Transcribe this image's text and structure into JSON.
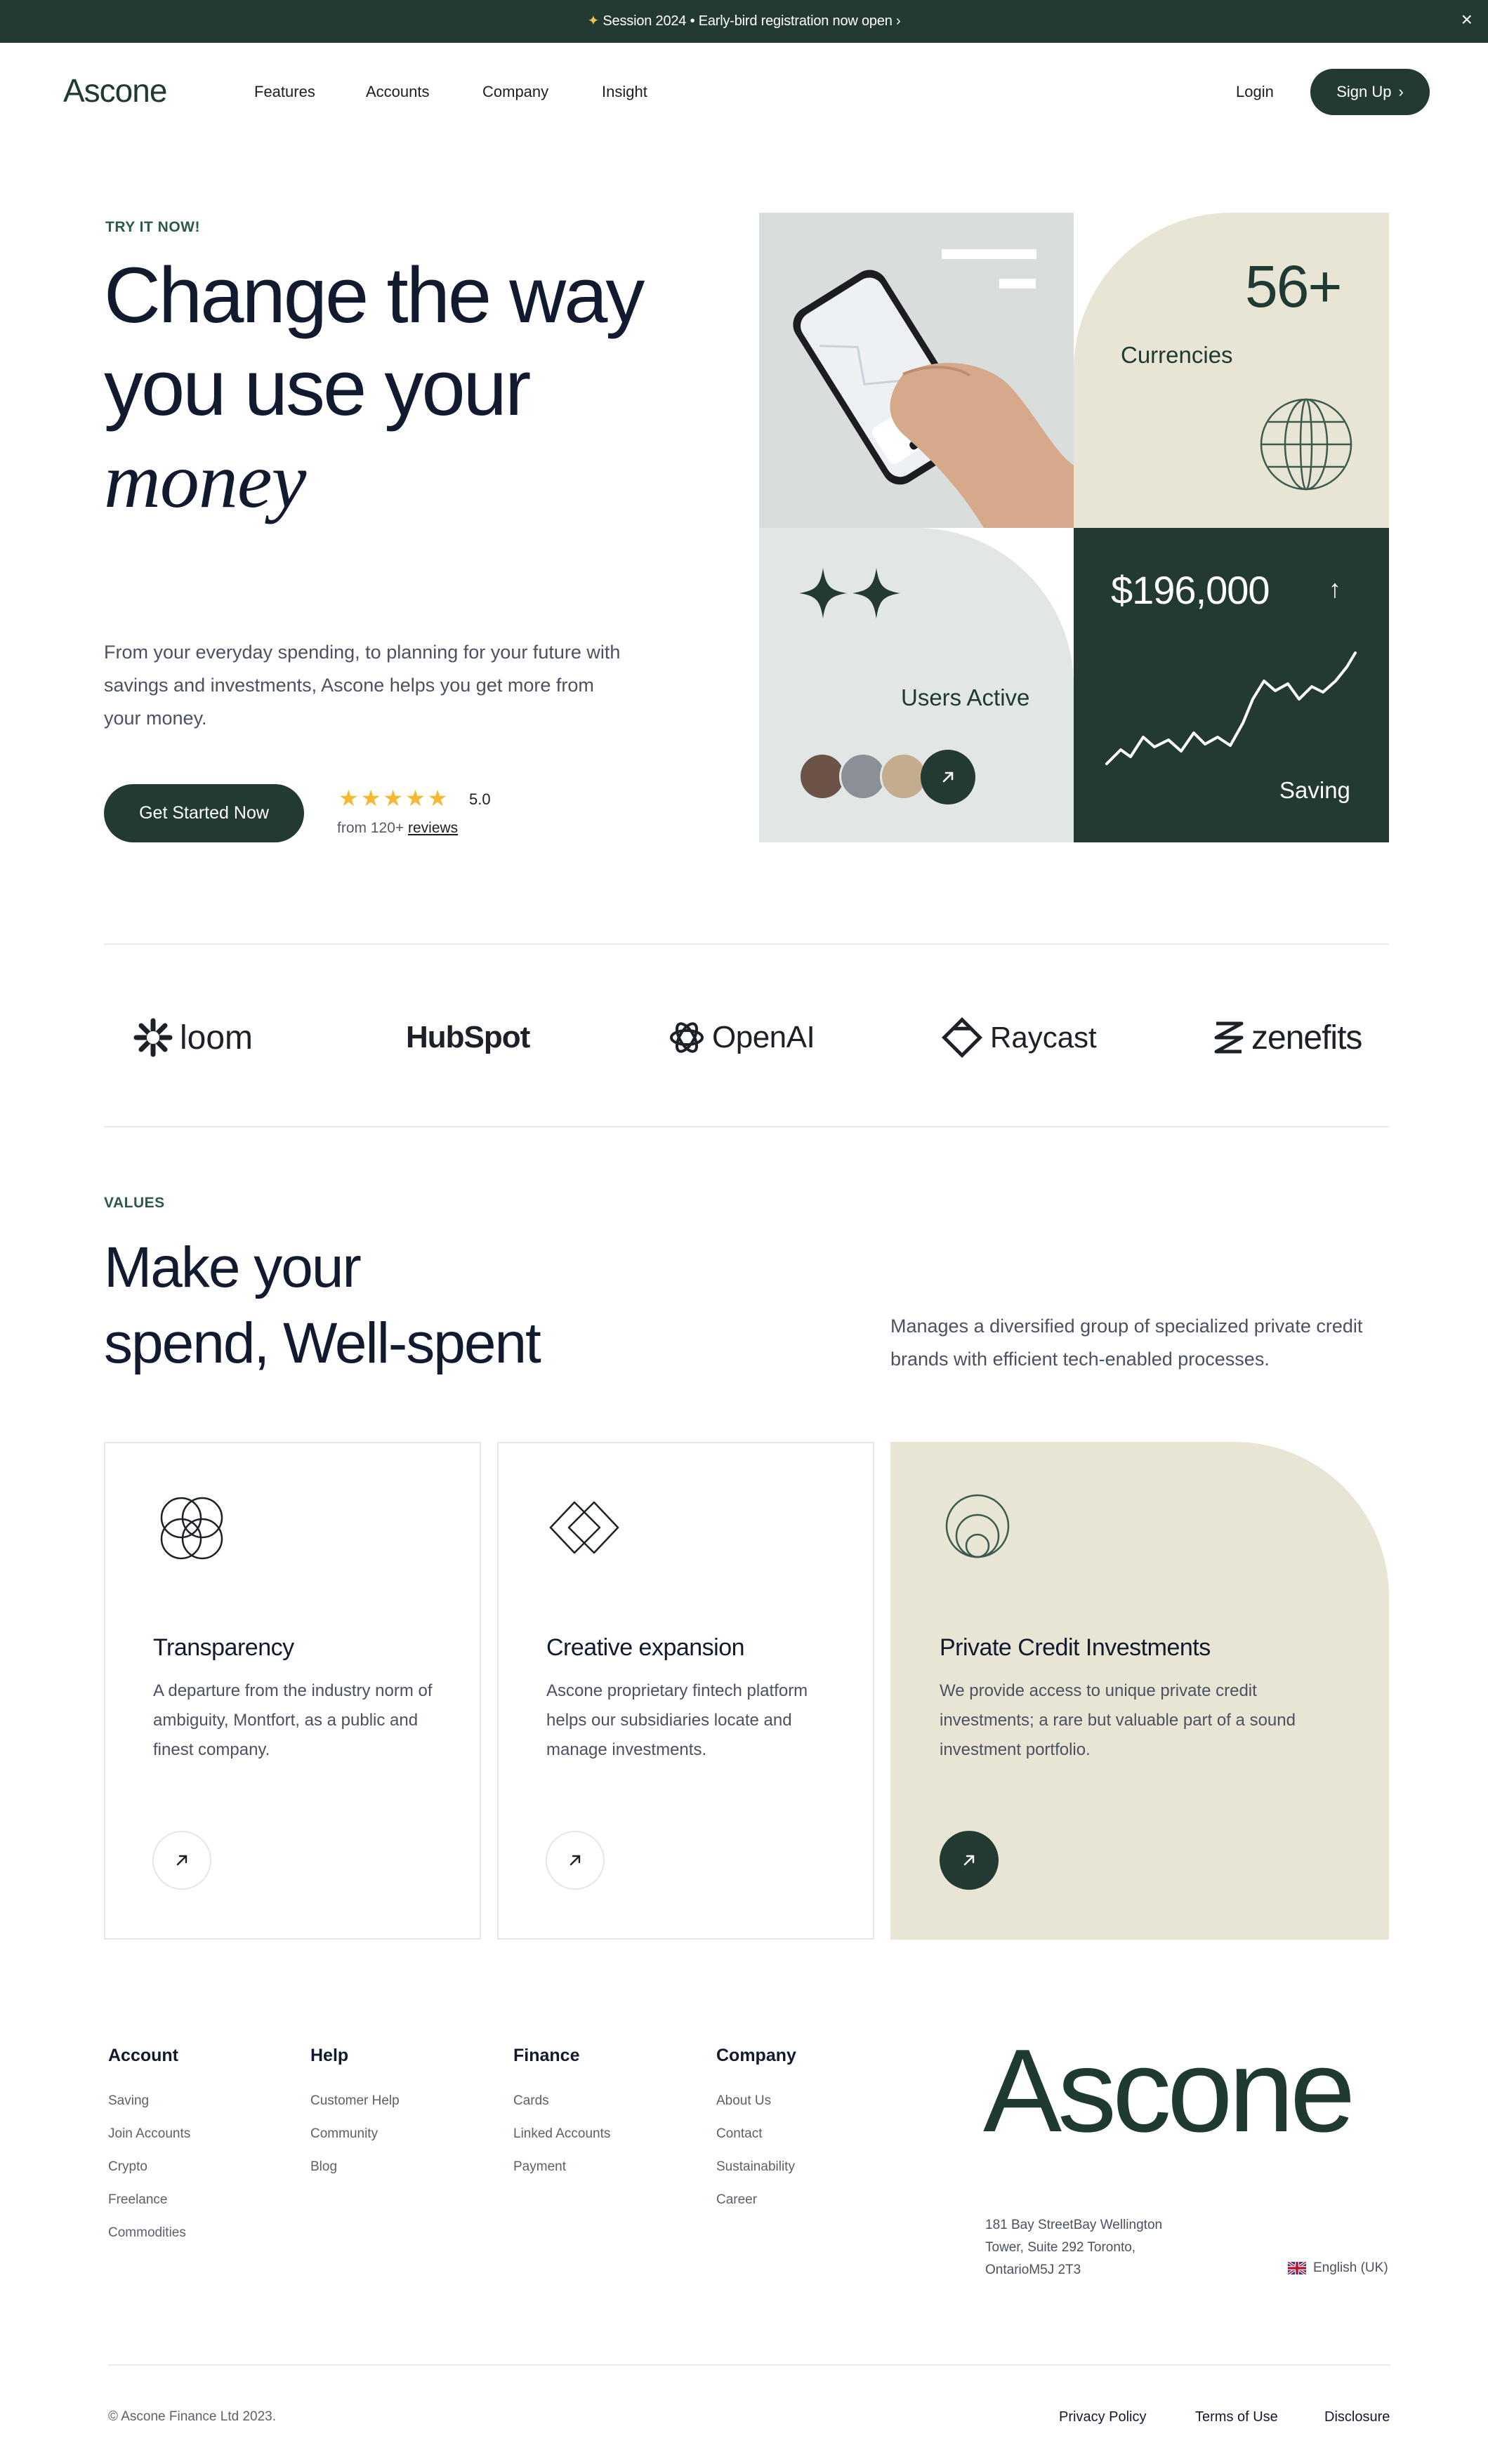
{
  "announcement": {
    "text": "Session 2024  •  Early-bird registration now open",
    "close": "×"
  },
  "brand": "Ascone",
  "nav": {
    "links": [
      "Features",
      "Accounts",
      "Company",
      "Insight"
    ],
    "login": "Login",
    "signup": "Sign Up"
  },
  "hero": {
    "eyebrow": "TRY IT NOW!",
    "title_line1": "Change the way",
    "title_line2": "you use your",
    "title_line3": "money",
    "description": "From your everyday spending, to planning for your future with savings and investments, Ascone helps you get more from your money.",
    "cta": "Get Started Now",
    "stars": "★★★★★",
    "rating": "5.0",
    "reviews_prefix": "from 120+",
    "reviews_link": "reviews"
  },
  "tiles": {
    "currencies_value": "56+",
    "currencies_label": "Currencies",
    "users_label": "Users Active",
    "saving_value": "$196,000",
    "saving_arrow": "↑",
    "saving_label": "Saving"
  },
  "logos": [
    "loom",
    "HubSpot",
    "OpenAI",
    "Raycast",
    "zenefits"
  ],
  "values": {
    "eyebrow": "VALUES",
    "title_line1": "Make your",
    "title_line2": "spend, Well-spent",
    "description": "Manages a diversified group of specialized private credit brands with efficient tech-enabled processes.",
    "cards": [
      {
        "title": "Transparency",
        "text": "A departure from the industry norm of ambiguity, Montfort, as a public and finest company.",
        "icon": "overlapping-circles-icon"
      },
      {
        "title": "Creative expansion",
        "text": "Ascone proprietary fintech platform helps our subsidiaries locate and manage investments.",
        "icon": "interlocking-diamonds-icon"
      },
      {
        "title": "Private Credit Investments",
        "text": "We provide access to unique private credit investments; a rare but valuable part of a sound investment portfolio.",
        "icon": "nested-circles-icon"
      }
    ]
  },
  "footer": {
    "columns": [
      {
        "heading": "Account",
        "links": [
          "Saving",
          "Join Accounts",
          "Crypto",
          "Freelance",
          "Commodities"
        ]
      },
      {
        "heading": "Help",
        "links": [
          "Customer Help",
          "Community",
          "Blog"
        ]
      },
      {
        "heading": "Finance",
        "links": [
          "Cards",
          "Linked Accounts",
          "Payment"
        ]
      },
      {
        "heading": "Company",
        "links": [
          "About Us",
          "Contact",
          "Sustainability",
          "Career"
        ]
      }
    ],
    "logo": "Ascone",
    "address_line1": "181 Bay StreetBay Wellington",
    "address_line2": "Tower, Suite 292 Toronto,",
    "address_line3": "OntarioM5J 2T3",
    "language": "English (UK)",
    "copyright": "© Ascone Finance Ltd 2023.",
    "legal": [
      "Privacy Policy",
      "Terms of Use",
      "Disclosure"
    ]
  },
  "colors": {
    "primary": "#233a32",
    "beige": "#e9e5d4",
    "sage": "#e2e7e5",
    "star": "#f5b82e"
  }
}
